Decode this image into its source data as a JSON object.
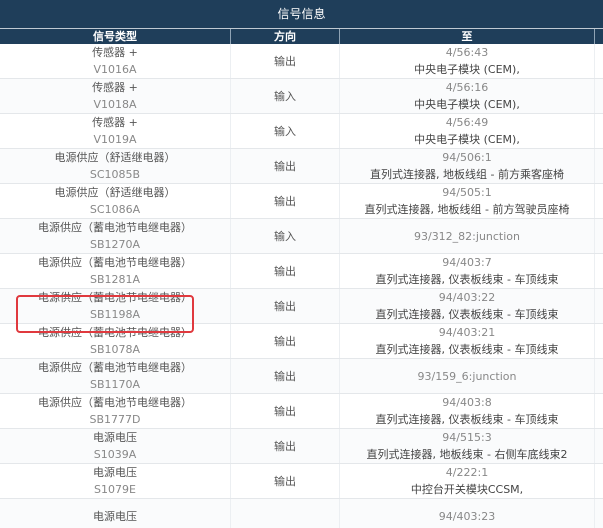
{
  "panel": {
    "title": "信号信息",
    "columns": [
      "信号类型",
      "方向",
      "至",
      ""
    ]
  },
  "rows": [
    {
      "type": "传感器 +",
      "code": "V1016A",
      "direction": "输出",
      "to_line1": "4/56:43",
      "to_line2": "中央电子模块 (CEM),"
    },
    {
      "type": "传感器 +",
      "code": "V1018A",
      "direction": "输入",
      "to_line1": "4/56:16",
      "to_line2": "中央电子模块 (CEM),"
    },
    {
      "type": "传感器 +",
      "code": "V1019A",
      "direction": "输入",
      "to_line1": "4/56:49",
      "to_line2": "中央电子模块 (CEM),"
    },
    {
      "type": "电源供应（舒适继电器）",
      "code": "SC1085B",
      "direction": "输出",
      "to_line1": "94/506:1",
      "to_line2": "直列式连接器, 地板线组 - 前方乘客座椅"
    },
    {
      "type": "电源供应（舒适继电器）",
      "code": "SC1086A",
      "direction": "输出",
      "to_line1": "94/505:1",
      "to_line2": "直列式连接器, 地板线组 - 前方驾驶员座椅"
    },
    {
      "type": "电源供应（蓄电池节电继电器）",
      "code": "SB1270A",
      "direction": "输入",
      "to_line1": "93/312_82:junction",
      "to_line2": ""
    },
    {
      "type": "电源供应（蓄电池节电继电器）",
      "code": "SB1281A",
      "direction": "输出",
      "to_line1": "94/403:7",
      "to_line2": "直列式连接器, 仪表板线束 - 车顶线束"
    },
    {
      "type": "电源供应（蓄电池节电继电器）",
      "code": "SB1198A",
      "direction": "输出",
      "to_line1": "94/403:22",
      "to_line2": "直列式连接器, 仪表板线束 - 车顶线束"
    },
    {
      "type": "电源供应（蓄电池节电继电器）",
      "code": "SB1078A",
      "direction": "输出",
      "to_line1": "94/403:21",
      "to_line2": "直列式连接器, 仪表板线束 - 车顶线束"
    },
    {
      "type": "电源供应（蓄电池节电继电器）",
      "code": "SB1170A",
      "direction": "输出",
      "to_line1": "93/159_6:junction",
      "to_line2": ""
    },
    {
      "type": "电源供应（蓄电池节电继电器）",
      "code": "SB1777D",
      "direction": "输出",
      "to_line1": "94/403:8",
      "to_line2": "直列式连接器, 仪表板线束 - 车顶线束"
    },
    {
      "type": "电源电压",
      "code": "S1039A",
      "direction": "输出",
      "to_line1": "94/515:3",
      "to_line2": "直列式连接器, 地板线束 - 右侧车底线束2"
    },
    {
      "type": "电源电压",
      "code": "S1079E",
      "direction": "输出",
      "to_line1": "4/222:1",
      "to_line2": "中控台开关模块CCSM,"
    },
    {
      "type": "电源电压",
      "code": "",
      "direction": "",
      "to_line1": "94/403:23",
      "to_line2": ""
    }
  ],
  "highlight": {
    "row_index": 7,
    "color": "#e0393e"
  },
  "colors": {
    "header_bg": "#1f3e5a",
    "header_text": "#ffffff"
  }
}
